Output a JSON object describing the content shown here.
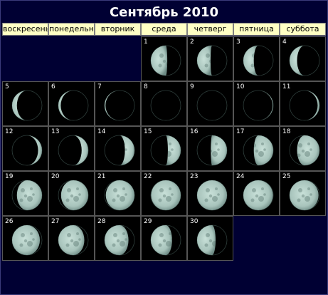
{
  "title": "Сентябрь 2010",
  "weekdays": [
    "воскресень",
    "понедельни",
    "вторник",
    "среда",
    "четверг",
    "пятница",
    "суббота"
  ],
  "month_start_weekday": 3,
  "days": [
    {
      "day": "1",
      "lit": 0.55,
      "waxing": false
    },
    {
      "day": "2",
      "lit": 0.45,
      "waxing": false
    },
    {
      "day": "3",
      "lit": 0.35,
      "waxing": false
    },
    {
      "day": "4",
      "lit": 0.25,
      "waxing": false
    },
    {
      "day": "5",
      "lit": 0.16,
      "waxing": false
    },
    {
      "day": "6",
      "lit": 0.08,
      "waxing": false
    },
    {
      "day": "7",
      "lit": 0.03,
      "waxing": false
    },
    {
      "day": "8",
      "lit": 0.0,
      "waxing": false
    },
    {
      "day": "9",
      "lit": 0.0,
      "waxing": true
    },
    {
      "day": "10",
      "lit": 0.02,
      "waxing": true
    },
    {
      "day": "11",
      "lit": 0.06,
      "waxing": true
    },
    {
      "day": "12",
      "lit": 0.13,
      "waxing": true
    },
    {
      "day": "13",
      "lit": 0.22,
      "waxing": true
    },
    {
      "day": "14",
      "lit": 0.32,
      "waxing": true
    },
    {
      "day": "15",
      "lit": 0.43,
      "waxing": true
    },
    {
      "day": "16",
      "lit": 0.54,
      "waxing": true
    },
    {
      "day": "17",
      "lit": 0.65,
      "waxing": true
    },
    {
      "day": "18",
      "lit": 0.75,
      "waxing": true
    },
    {
      "day": "19",
      "lit": 0.84,
      "waxing": true
    },
    {
      "day": "20",
      "lit": 0.91,
      "waxing": true
    },
    {
      "day": "21",
      "lit": 0.96,
      "waxing": true
    },
    {
      "day": "22",
      "lit": 0.99,
      "waxing": true
    },
    {
      "day": "23",
      "lit": 1.0,
      "waxing": true
    },
    {
      "day": "24",
      "lit": 0.99,
      "waxing": false
    },
    {
      "day": "25",
      "lit": 0.97,
      "waxing": false
    },
    {
      "day": "26",
      "lit": 0.93,
      "waxing": false
    },
    {
      "day": "27",
      "lit": 0.87,
      "waxing": false
    },
    {
      "day": "28",
      "lit": 0.8,
      "waxing": false
    },
    {
      "day": "29",
      "lit": 0.71,
      "waxing": false
    },
    {
      "day": "30",
      "lit": 0.62,
      "waxing": false
    }
  ],
  "colors": {
    "background": "#000033",
    "header_bg": "#ffffc4",
    "moon_light": "#a8c4bc",
    "moon_dark": "#000000",
    "day_number": "#ffffff"
  }
}
